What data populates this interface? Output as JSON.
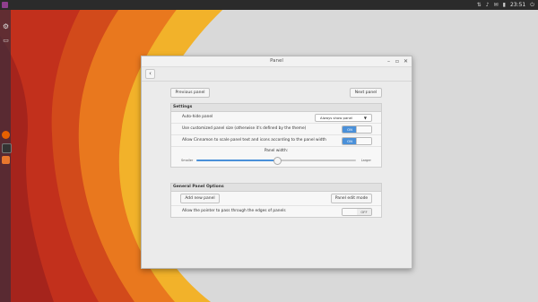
{
  "desktop": {
    "clock": "23:51",
    "status_icons": [
      "network-icon",
      "volume-icon",
      "mail-icon",
      "battery-icon"
    ]
  },
  "window": {
    "title": "Panel",
    "controls": [
      "–",
      "▫",
      "✕"
    ]
  },
  "nav": {
    "back_symbol": "‹",
    "previous_label": "Previous panel",
    "next_label": "Next panel"
  },
  "settings": {
    "header": "Settings",
    "autohide": {
      "label": "Auto-hide panel",
      "value": "Always show panel"
    },
    "custom_size": {
      "label": "Use customized panel size (otherwise it's defined by the theme)",
      "state": "ON"
    },
    "scale_text": {
      "label": "Allow Cinnamon to scale panel text and icons according to the panel width",
      "state": "ON"
    },
    "width": {
      "label": "Panel width:",
      "min_label": "Smaller",
      "max_label": "Larger",
      "value": 0.5
    }
  },
  "general": {
    "header": "General Panel Options",
    "add_label": "Add new panel",
    "edit_label": "Panel edit mode",
    "pass_through": {
      "label": "Allow the pointer to pass through the edges of panels",
      "state": "OFF"
    }
  },
  "colors": {
    "accent": "#4a90d9",
    "wallpaper_red": "#c2301c",
    "wallpaper_orange": "#e9781e",
    "wallpaper_yellow": "#f2b22a"
  }
}
